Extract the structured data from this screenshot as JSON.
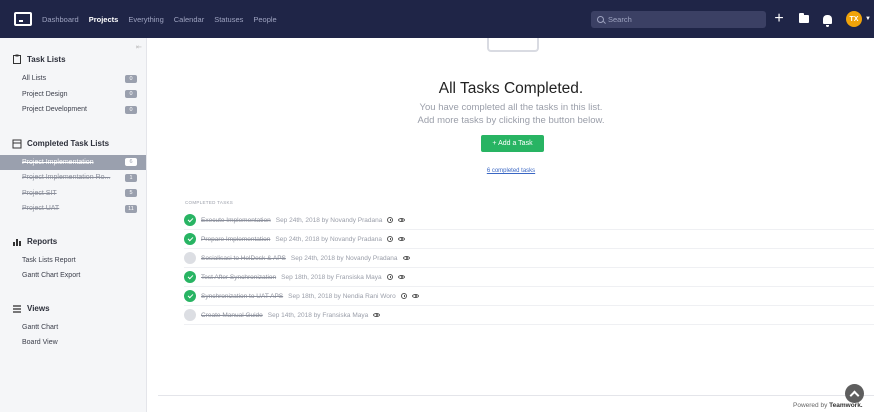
{
  "nav": {
    "items": [
      "Dashboard",
      "Projects",
      "Everything",
      "Calendar",
      "Statuses",
      "People"
    ],
    "active": "Projects",
    "search_placeholder": "Search",
    "avatar_initials": "TX"
  },
  "sidebar": {
    "task_lists_title": "Task Lists",
    "task_lists": [
      {
        "label": "All Lists",
        "count": "0"
      },
      {
        "label": "Project Design",
        "count": "0"
      },
      {
        "label": "Project Development",
        "count": "0"
      }
    ],
    "completed_title": "Completed Task Lists",
    "completed_lists": [
      {
        "label": "Project Implementation",
        "count": "6"
      },
      {
        "label": "Project Implementation Ro...",
        "count": "1"
      },
      {
        "label": "Project SIT",
        "count": "5"
      },
      {
        "label": "Project UAT",
        "count": "11"
      }
    ],
    "reports_title": "Reports",
    "reports": [
      "Task Lists Report",
      "Gantt Chart Export"
    ],
    "views_title": "Views",
    "views": [
      "Gantt Chart",
      "Board View"
    ]
  },
  "main": {
    "title": "All Tasks Completed.",
    "subtitle_1": "You have completed all the tasks in this list.",
    "subtitle_2": "Add more tasks by clicking the button below.",
    "add_button": "+ Add a Task",
    "completed_link": "6 completed tasks",
    "completed_header": "COMPLETED TASKS",
    "tasks": [
      {
        "name": "Execute Implementation",
        "meta": "Sep 24th, 2018 by Novandy Pradana",
        "checked": true,
        "clock": true
      },
      {
        "name": "Prepare Implementation",
        "meta": "Sep 24th, 2018 by Novandy Pradana",
        "checked": true,
        "clock": true
      },
      {
        "name": "Sosialisasi to HelDesk & APS",
        "meta": "Sep 24th, 2018 by Novandy Pradana",
        "checked": false,
        "clock": false
      },
      {
        "name": "Test After Synchronization",
        "meta": "Sep 18th, 2018 by Fransiska Maya",
        "checked": true,
        "clock": true
      },
      {
        "name": "Synchronization to UAT APS",
        "meta": "Sep 18th, 2018 by Nendia Rani Woro",
        "checked": true,
        "clock": true
      },
      {
        "name": "Create Manual Guide",
        "meta": "Sep 14th, 2018 by Fransiska Maya",
        "checked": false,
        "clock": false
      }
    ]
  },
  "footer": {
    "powered_prefix": "Powered by",
    "powered_brand": "Teamwork."
  },
  "colors": {
    "nav_bg": "#1f2547",
    "accent_green": "#28b463",
    "selected_bg": "#9aa0ae",
    "avatar": "#f0a30a"
  }
}
